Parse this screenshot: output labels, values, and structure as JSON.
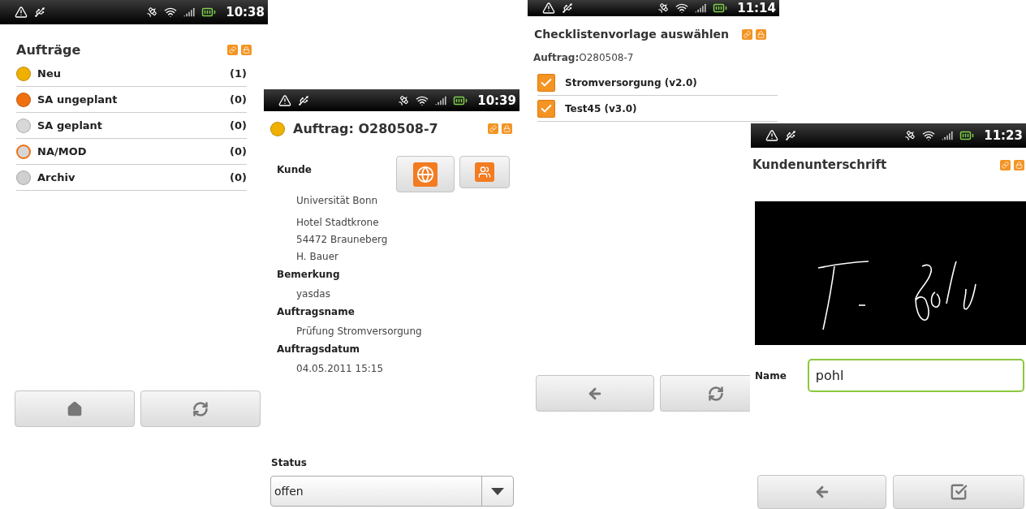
{
  "orders_screen": {
    "status_time": "10:38",
    "title": "Aufträge",
    "items": [
      {
        "label": "Neu",
        "count": "(1)",
        "color": "#f0b000",
        "kind": "filled"
      },
      {
        "label": "SA ungeplant",
        "count": "(0)",
        "color": "#f07010",
        "kind": "filled"
      },
      {
        "label": "SA geplant",
        "count": "(0)",
        "color": "#d8d8d8",
        "kind": "filled"
      },
      {
        "label": "NA/MOD",
        "count": "(0)",
        "color": "#f07010",
        "kind": "outlined"
      },
      {
        "label": "Archiv",
        "count": "(0)",
        "color": "#d0d0d0",
        "kind": "filled"
      }
    ]
  },
  "order_detail_screen": {
    "status_time": "10:39",
    "title": "Auftrag: O280508-7",
    "status_dot": {
      "color": "#f0b000"
    },
    "sections": [
      {
        "label": "Kunde",
        "lines": [
          [
            "Universität Bonn"
          ],
          [
            "Hotel Stadtkrone",
            "54472 Brauneberg",
            "H. Bauer"
          ]
        ]
      },
      {
        "label": "Bemerkung",
        "lines": [
          [
            "yasdas"
          ]
        ]
      },
      {
        "label": "Auftragsname",
        "lines": [
          [
            "Prüfung Stromversorgung"
          ]
        ]
      },
      {
        "label": "Auftragsdatum",
        "lines": [
          [
            "04.05.2011 15:15"
          ]
        ]
      }
    ],
    "status_label": "Status",
    "status_value": "offen"
  },
  "checklist_screen": {
    "status_time": "11:14",
    "title": "Checklistenvorlage auswählen",
    "order": "**Auftrag:**O280508-7",
    "items": [
      {
        "label": "Stromversorgung (v2.0)",
        "checked": true
      },
      {
        "label": "Test45 (v3.0)",
        "checked": true
      }
    ]
  },
  "signature_screen": {
    "status_time": "11:23",
    "title": "Kundenunterschrift",
    "name_label": "Name",
    "name_value": "pohl",
    "name_focused": true
  }
}
